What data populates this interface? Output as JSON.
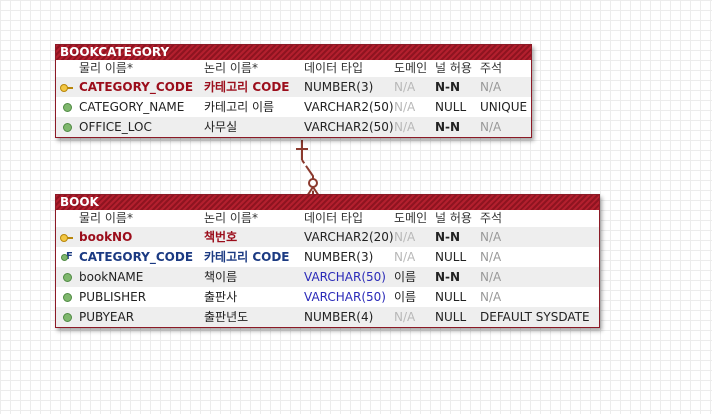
{
  "columns": {
    "physical": "물리 이름*",
    "logical": "논리 이름*",
    "datatype": "데이터 타입",
    "domain": "도메인",
    "nullable": "널 허용",
    "note": "주석"
  },
  "entities": [
    {
      "name": "BOOKCATEGORY",
      "rows": [
        {
          "key": "pk",
          "physical": "CATEGORY_CODE",
          "logical": "카테고리 CODE",
          "datatype": "NUMBER(3)",
          "domain": "N/A",
          "nullable": "N-N",
          "note": "N/A"
        },
        {
          "key": "none",
          "physical": "CATEGORY_NAME",
          "logical": "카테고리 이름",
          "datatype": "VARCHAR2(50)",
          "domain": "N/A",
          "nullable": "NULL",
          "note": "UNIQUE"
        },
        {
          "key": "none",
          "physical": "OFFICE_LOC",
          "logical": "사무실",
          "datatype": "VARCHAR2(50)",
          "domain": "N/A",
          "nullable": "N-N",
          "note": "N/A"
        }
      ]
    },
    {
      "name": "BOOK",
      "rows": [
        {
          "key": "pk",
          "physical": "bookNO",
          "logical": "책번호",
          "datatype": "VARCHAR2(20)",
          "domain": "N/A",
          "nullable": "N-N",
          "note": "N/A"
        },
        {
          "key": "fk",
          "physical": "CATEGORY_CODE",
          "logical": "카테고리 CODE",
          "datatype": "NUMBER(3)",
          "domain": "N/A",
          "nullable": "NULL",
          "note": "N/A"
        },
        {
          "key": "none",
          "physical": "bookNAME",
          "logical": "책이름",
          "datatype": "VARCHAR(50)",
          "domain": "이름",
          "nullable": "N-N",
          "note": "N/A"
        },
        {
          "key": "none",
          "physical": "PUBLISHER",
          "logical": "출판사",
          "datatype": "VARCHAR(50)",
          "domain": "이름",
          "nullable": "NULL",
          "note": "N/A"
        },
        {
          "key": "none",
          "physical": "PUBYEAR",
          "logical": "출판년도",
          "datatype": "NUMBER(4)",
          "domain": "N/A",
          "nullable": "NULL",
          "note": "DEFAULT SYSDATE"
        }
      ]
    }
  ],
  "colors": {
    "relationship": "#8b3a2e",
    "header": "#a01b2a",
    "pk_text": "#9b0d1b",
    "fk_text": "#1b3a82",
    "domain_type": "#2a2ab8"
  }
}
